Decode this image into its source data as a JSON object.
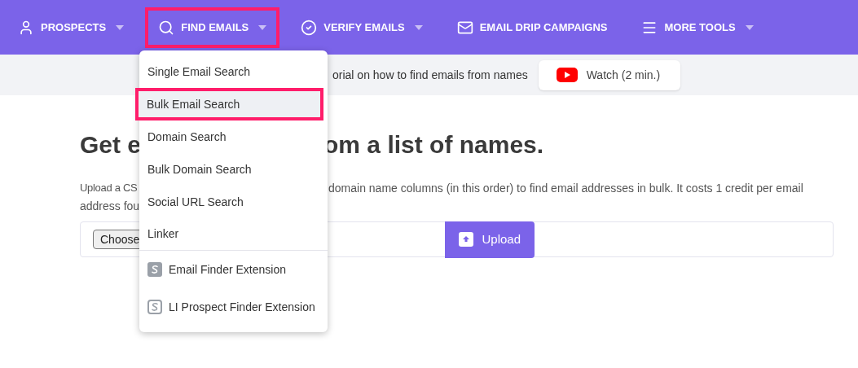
{
  "nav": [
    {
      "label": "PROSPECTS",
      "caret": true,
      "selected": false
    },
    {
      "label": "FIND EMAILS",
      "caret": true,
      "selected": true
    },
    {
      "label": "VERIFY EMAILS",
      "caret": true,
      "selected": false
    },
    {
      "label": "EMAIL DRIP CAMPAIGNS",
      "caret": false,
      "selected": false
    },
    {
      "label": "MORE TOOLS",
      "caret": true,
      "selected": false
    }
  ],
  "banner": {
    "text": "orial on how to find emails from names",
    "watch_button": "Watch (2 min.)"
  },
  "heading": {
    "start": "Get e",
    "end": "om a list of names."
  },
  "description": {
    "start_line1": "Upload a CS",
    "end_line1": "domain name columns (in this order) to find email addresses in bulk. It costs 1 credit per email",
    "start_line2": "address fou"
  },
  "upload_form": {
    "choose_button": "Choose",
    "upload_button": "Upload"
  },
  "dropdown": {
    "items": [
      {
        "kind": "link",
        "label": "Single Email Search",
        "selected": false
      },
      {
        "kind": "link",
        "label": "Bulk Email Search",
        "selected": true
      },
      {
        "kind": "link",
        "label": "Domain Search",
        "selected": false
      },
      {
        "kind": "link",
        "label": "Bulk Domain Search",
        "selected": false
      },
      {
        "kind": "link",
        "label": "Social URL Search",
        "selected": false
      },
      {
        "kind": "link",
        "label": "Linker",
        "selected": false
      },
      {
        "kind": "extension",
        "label": "Email Finder Extension",
        "selected": false
      },
      {
        "kind": "extension",
        "label": "LI Prospect Finder Extension",
        "selected": false
      }
    ]
  }
}
